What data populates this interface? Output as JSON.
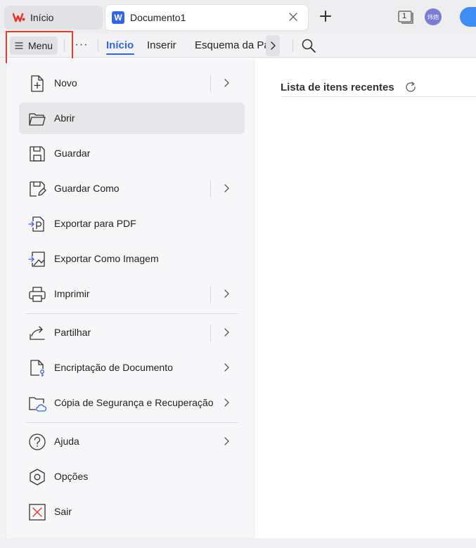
{
  "titlebar": {
    "home_tab_label": "Início",
    "doc_tab_label": "Documento1",
    "doc_badge": "W",
    "window_count": "1",
    "avatar_text": "炜炮"
  },
  "ribbon": {
    "menu_label": "Menu",
    "more_label": "···",
    "tabs": [
      "Início",
      "Inserir",
      "Esquema da Página"
    ]
  },
  "backstage": {
    "items": [
      {
        "label": "Novo",
        "icon": "new-document-icon"
      },
      {
        "label": "Abrir",
        "icon": "open-folder-icon"
      },
      {
        "label": "Guardar",
        "icon": "save-icon"
      },
      {
        "label": "Guardar Como",
        "icon": "save-as-icon"
      },
      {
        "label": "Exportar para PDF",
        "icon": "export-pdf-icon"
      },
      {
        "label": "Exportar Como Imagem",
        "icon": "export-image-icon"
      },
      {
        "label": "Imprimir",
        "icon": "printer-icon"
      },
      {
        "label": "Partilhar",
        "icon": "share-icon"
      },
      {
        "label": "Encriptação de Documento",
        "icon": "encrypt-document-icon"
      },
      {
        "label": "Cópia de Segurança e Recuperação",
        "icon": "backup-cloud-icon"
      },
      {
        "label": "Ajuda",
        "icon": "help-icon"
      },
      {
        "label": "Opções",
        "icon": "options-icon"
      },
      {
        "label": "Sair",
        "icon": "exit-icon"
      }
    ]
  },
  "recent": {
    "title": "Lista de itens recentes"
  },
  "colors": {
    "accent": "#2f66e7",
    "highlight_box": "#e33b2c",
    "wps_logo": "#e8362a"
  }
}
